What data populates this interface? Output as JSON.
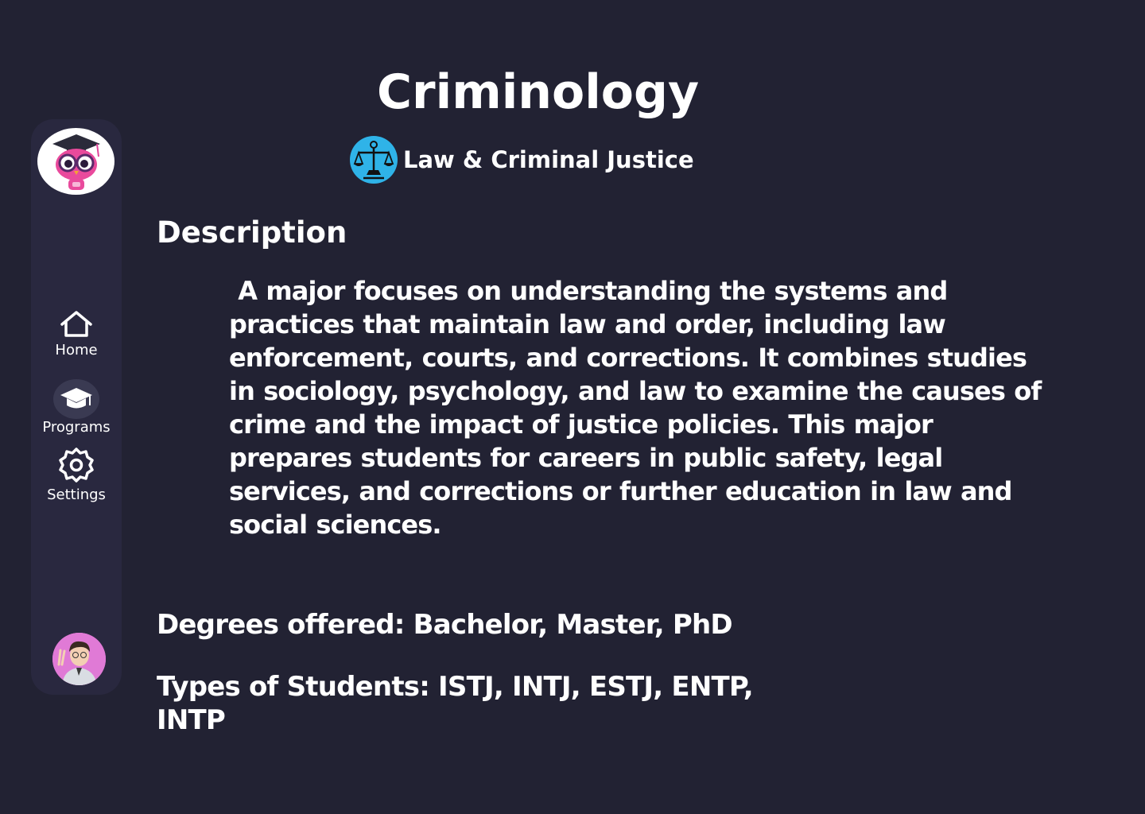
{
  "sidebar": {
    "logo_icon": "owl-graduate-logo",
    "items": [
      {
        "label": "Home",
        "icon": "home-icon"
      },
      {
        "label": "Programs",
        "icon": "graduation-cap-icon"
      },
      {
        "label": "Settings",
        "icon": "gear-icon"
      }
    ],
    "avatar_icon": "user-avatar",
    "background": "#29283f"
  },
  "program": {
    "title": "Criminology",
    "category": "Law & Criminal Justice",
    "category_icon": "scales-of-justice-icon",
    "category_color": "#2fb3e8"
  },
  "description": {
    "heading": "Description",
    "text": "A major focuses on understanding the systems and practices that maintain law and order, including law enforcement, courts, and corrections. It combines studies in sociology, psychology, and law to examine the causes of crime and the impact of justice policies. This major prepares students for careers in public safety, legal services, and corrections or further education in law and social sciences."
  },
  "degrees": "Degrees offered: Bachelor, Master, PhD",
  "student_types": "Types of  Students: ISTJ, INTJ, ESTJ, ENTP, INTP",
  "colors": {
    "background": "#222233",
    "text": "#ffffff"
  }
}
